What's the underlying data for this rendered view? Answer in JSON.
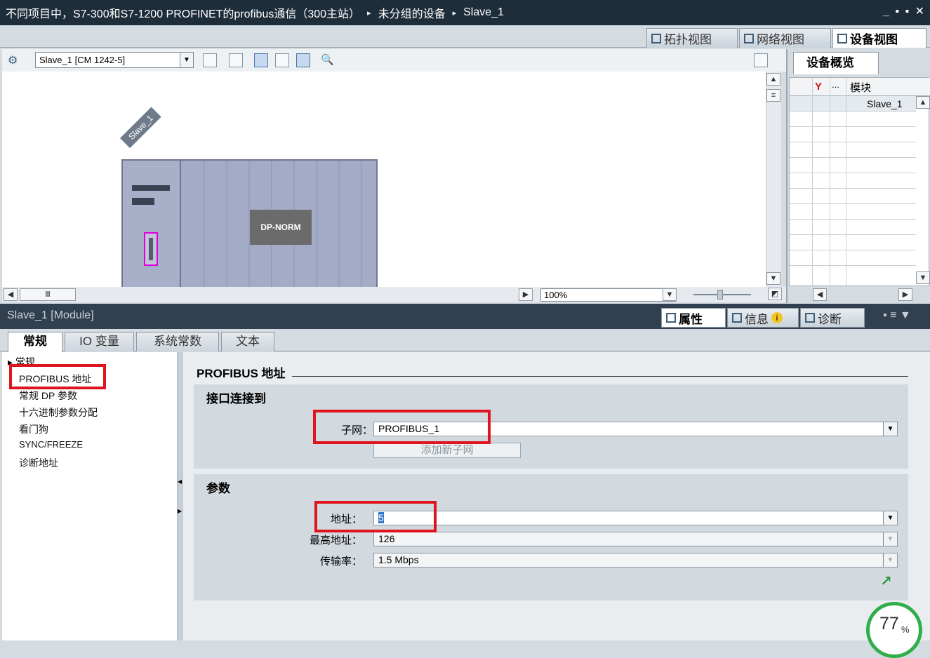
{
  "title_bar": {
    "project": "不同项目中，S7-300和S7-1200 PROFINET的profibus通信（300主站）",
    "group": "未分组的设备",
    "device": "Slave_1",
    "separator": "▸",
    "controls": "_ ▪ ▪ ✕"
  },
  "view_tabs": [
    {
      "label": "拓扑视图",
      "icon": "topology-icon"
    },
    {
      "label": "网络视图",
      "icon": "network-icon"
    },
    {
      "label": "设备视图",
      "icon": "device-icon",
      "active": true
    }
  ],
  "toolbar": {
    "device_select": "Slave_1 [CM 1242-5]",
    "zoom_label": "100%"
  },
  "canvas": {
    "rack_label": "Slave_1",
    "module_label": "DP-NORM"
  },
  "overview": {
    "tab": "设备概览",
    "col_dots": "...",
    "col_module": "模块",
    "row_module": "Slave_1"
  },
  "properties": {
    "object_title": "Slave_1 [Module]",
    "tabs": [
      {
        "label": "属性",
        "active": true
      },
      {
        "label": "信息"
      },
      {
        "label": "诊断"
      }
    ],
    "sub_tabs": [
      {
        "label": "常规",
        "active": true
      },
      {
        "label": "IO 变量"
      },
      {
        "label": "系统常数"
      },
      {
        "label": "文本"
      }
    ],
    "nav": {
      "group": "常规",
      "items": [
        "PROFIBUS 地址",
        "常规 DP 参数",
        "十六进制参数分配",
        "看门狗",
        "SYNC/FREEZE",
        "诊断地址"
      ]
    },
    "section_title": "PROFIBUS 地址",
    "interface": {
      "title": "接口连接到",
      "subnet_label": "子网：",
      "subnet_value": "PROFIBUS_1",
      "add_button": "添加新子网"
    },
    "params": {
      "title": "参数",
      "address_label": "地址：",
      "address_value": "5",
      "max_label": "最高地址：",
      "max_value": "126",
      "rate_label": "传输率：",
      "rate_value": "1.5 Mbps"
    }
  },
  "gauge": {
    "value": "77",
    "unit": "%",
    "percent": 77
  },
  "colors": {
    "highlight": "#e0141e",
    "titlebar": "#1e2d3a",
    "module": "#a4abc6",
    "port": "#e000e0",
    "gauge": "#2fae4a"
  }
}
